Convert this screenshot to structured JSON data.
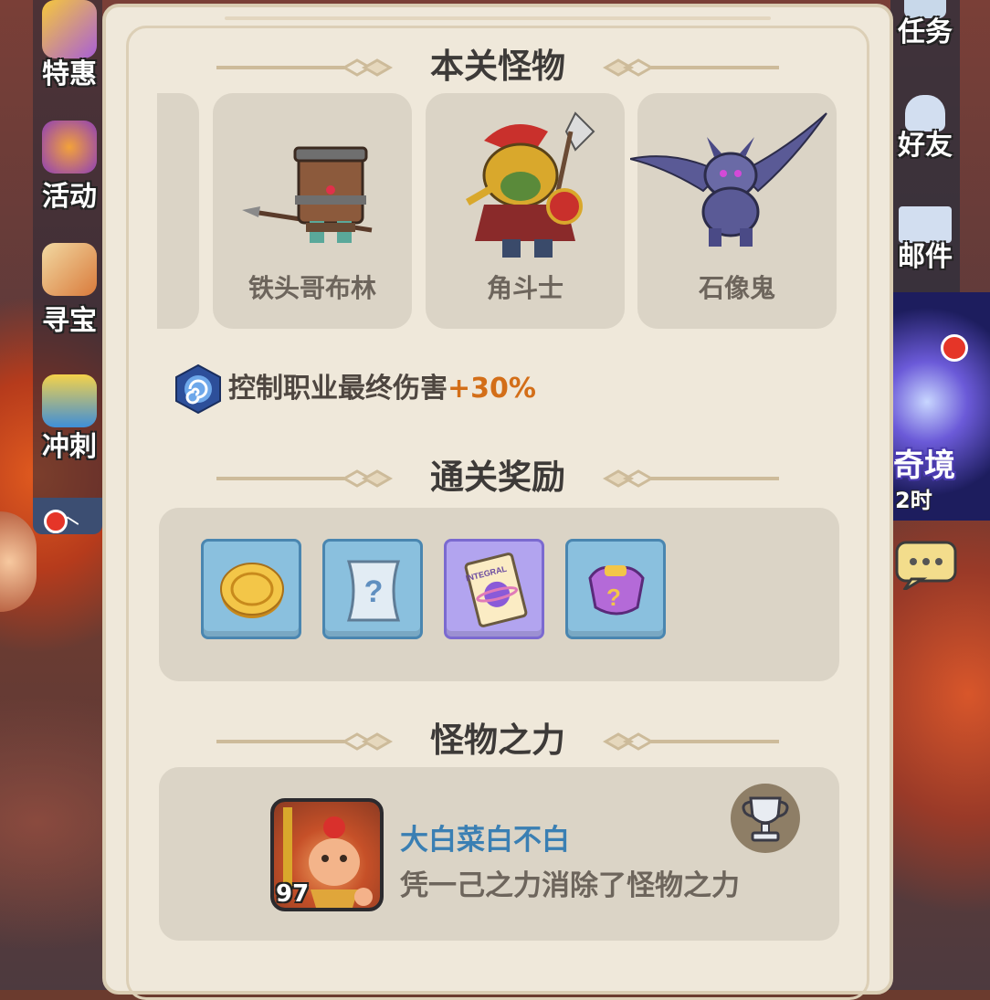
{
  "left_menu": [
    {
      "label": "特惠",
      "icon": "gift-card-icon"
    },
    {
      "label": "活动",
      "icon": "fruit-basket-icon"
    },
    {
      "label": "寻宝",
      "icon": "treasure-map-icon"
    },
    {
      "label": "冲刺",
      "icon": "trophy-sprint-icon"
    }
  ],
  "right_menu": [
    {
      "label": "任务",
      "icon": "task-list-icon"
    },
    {
      "label": "好友",
      "icon": "friends-icon"
    },
    {
      "label": "邮件",
      "icon": "mail-icon"
    }
  ],
  "event": {
    "title": "奇境",
    "time": "2时"
  },
  "sections": {
    "monsters_title": "本关怪物",
    "rewards_title": "通关奖励",
    "power_title": "怪物之力"
  },
  "monsters": [
    {
      "name": "铁头哥布林",
      "icon": "iron-head-goblin-icon"
    },
    {
      "name": "角斗士",
      "icon": "gladiator-orc-icon"
    },
    {
      "name": "石像鬼",
      "icon": "gargoyle-icon"
    }
  ],
  "buff": {
    "text": "控制职业最终伤害",
    "value": "+30%",
    "icon": "swirl-hexagon-icon"
  },
  "rewards": [
    {
      "icon": "gold-coin-icon",
      "frame": "blue"
    },
    {
      "icon": "mystery-scroll-icon",
      "frame": "blue"
    },
    {
      "icon": "integral-ticket-icon",
      "frame": "purple",
      "text": "INTEGRAL"
    },
    {
      "icon": "mystery-armor-icon",
      "frame": "blue"
    }
  ],
  "player": {
    "name": "大白菜白不白",
    "description": "凭一己之力消除了怪物之力",
    "level": "97",
    "icon": "trophy-cup-icon"
  },
  "colors": {
    "panel_bg": "#efe8da",
    "card_bg": "#dbd4c6",
    "title_text": "#3d3a38",
    "buff_value": "#d36e18",
    "player_name": "#3a7fb3"
  }
}
